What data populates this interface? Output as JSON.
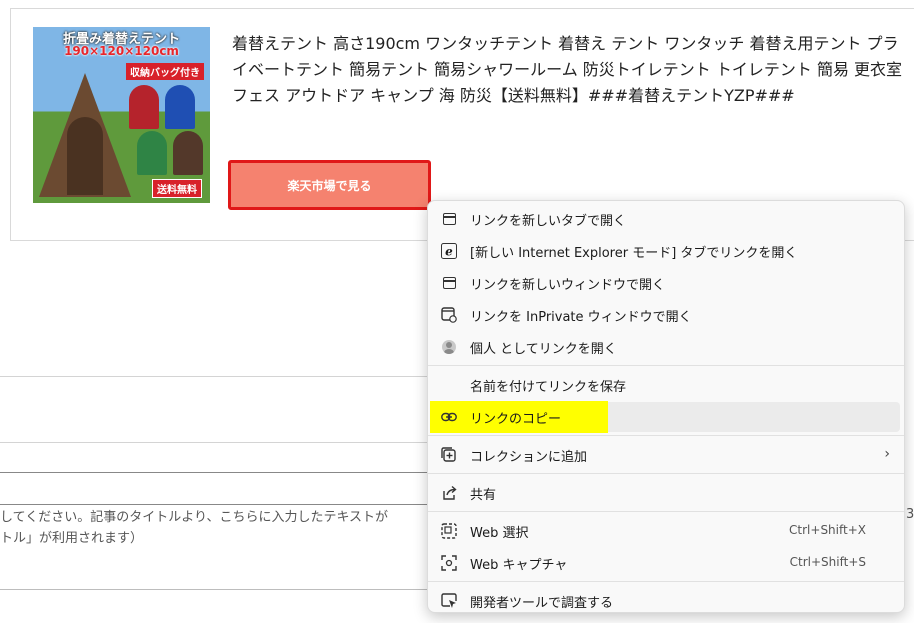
{
  "product": {
    "image": {
      "title_text": "折畳み着替えテント",
      "size_text": "190×120×120cm",
      "bag_badge": "収納バッグ付き",
      "shipping_badge": "送料無料"
    },
    "title": "着替えテント 高さ190cm ワンタッチテント 着替え テント ワンタッチ 着替え用テント プライベートテント 簡易テント 簡易シャワールーム 防災トイレテント トイレテント 簡易 更衣室 フェス アウトドア キャンプ 海 防災【送料無料】###着替えテントYZP###",
    "button_label": "楽天市場で見る"
  },
  "background_page": {
    "help_line_1": "してください。記事のタイトルより、こちらに入力したテキストが",
    "help_line_2": "トル」が利用されます）",
    "right_digit": "3"
  },
  "context_menu": {
    "items": [
      {
        "label": "リンクを新しいタブで開く",
        "icon": "new-tab-icon"
      },
      {
        "label": "[新しい Internet Explorer モード] タブでリンクを開く",
        "icon": "internet-explorer-icon"
      },
      {
        "label": "リンクを新しいウィンドウで開く",
        "icon": "new-window-icon"
      },
      {
        "label": "リンクを InPrivate ウィンドウで開く",
        "icon": "inprivate-window-icon"
      },
      {
        "label": "個人 としてリンクを開く",
        "icon": "profile-avatar-icon"
      },
      {
        "label": "名前を付けてリンクを保存",
        "icon": ""
      },
      {
        "label": "リンクのコピー",
        "icon": "link-icon",
        "highlighted": true,
        "highlight_color": "#ffff00"
      },
      {
        "label": "コレクションに追加",
        "icon": "add-collection-icon",
        "has_submenu": true
      },
      {
        "label": "共有",
        "icon": "share-icon"
      },
      {
        "label": "Web 選択",
        "icon": "web-select-icon",
        "shortcut": "Ctrl+Shift+X"
      },
      {
        "label": "Web キャプチャ",
        "icon": "web-capture-icon",
        "shortcut": "Ctrl+Shift+S"
      },
      {
        "label": "開発者ツールで調査する",
        "icon": "inspect-icon"
      }
    ]
  },
  "colors": {
    "button_fill": "#f5826f",
    "button_border": "#e01818",
    "highlight": "#ffff00",
    "menu_background": "#f9f9f9"
  }
}
